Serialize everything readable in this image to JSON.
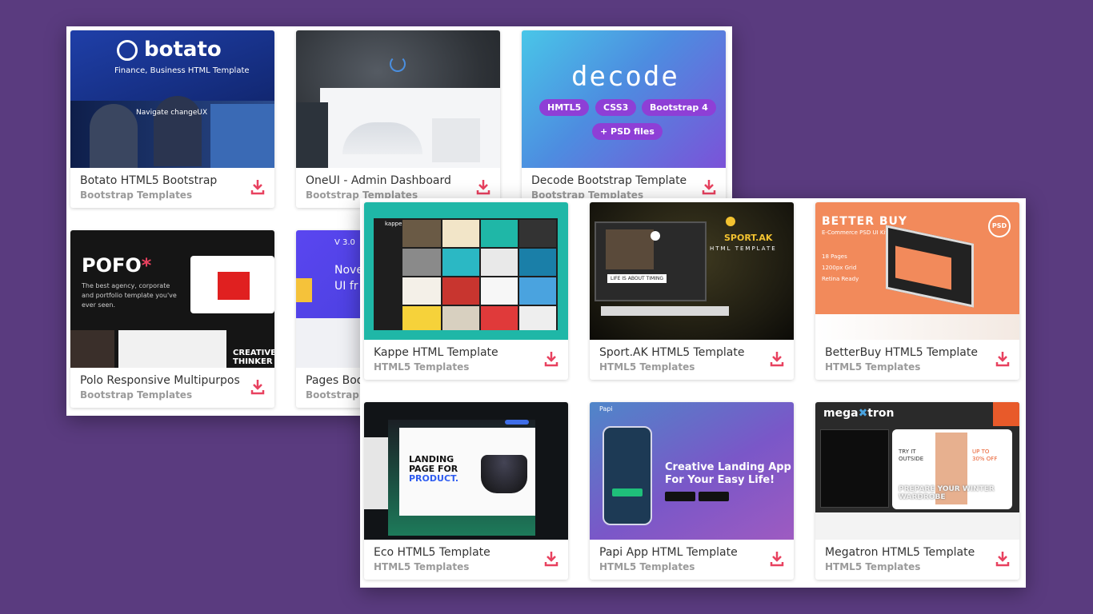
{
  "panels": {
    "back": [
      {
        "title": "Botato HTML5 Bootstrap",
        "category": "Bootstrap Templates",
        "thumb": {
          "brand": "botato",
          "subtitle": "Finance, Business HTML Template",
          "hero_text": "Navigate changeUX"
        }
      },
      {
        "title": "OneUI - Admin Dashboard",
        "category": "Bootstrap Templates"
      },
      {
        "title": "Decode Bootstrap Template",
        "category": "Bootstrap Templates",
        "thumb": {
          "brand": "decode",
          "pills": [
            "HMTL5",
            "CSS3",
            "Bootstrap 4",
            "+ PSD files"
          ]
        }
      },
      {
        "title": "Polo Responsive Multipurpose",
        "category": "Bootstrap Templates",
        "thumb": {
          "brand": "POFO",
          "brand_mark": "*",
          "tagline": "The best agency, corporate and portfolio template you've ever seen.",
          "side_text": "CREATIVE THINKER"
        }
      },
      {
        "title": "Pages Boo",
        "category": "Bootstrap T",
        "thumb": {
          "version": "V 3.0",
          "hero": "Nove UI fr"
        }
      }
    ],
    "front": [
      {
        "title": "Kappe HTML Template",
        "category": "HTML5 Templates",
        "thumb": {
          "brand": "kappe"
        }
      },
      {
        "title": "Sport.AK HTML5 Template",
        "category": "HTML5 Templates",
        "thumb": {
          "brand": "SPORT.AK",
          "sub": "HTML TEMPLATE",
          "banner": "LIFE IS ABOUT TIMING"
        }
      },
      {
        "title": "BetterBuy HTML5 Template",
        "category": "HTML5 Templates",
        "thumb": {
          "brand": "BETTER BUY",
          "sub": "E-Commerce PSD UI Kit",
          "features": [
            "18 Pages",
            "1200px Grid",
            "Retina Ready"
          ],
          "badge": "PSD"
        }
      },
      {
        "title": "Eco HTML5 Template",
        "category": "HTML5 Templates",
        "thumb": {
          "hero": [
            "LANDING",
            "PAGE FOR",
            "PRODUCT."
          ]
        }
      },
      {
        "title": "Papi App HTML Template",
        "category": "HTML5 Templates",
        "thumb": {
          "brand": "Papi",
          "hero": [
            "Creative Landing App",
            "For Your Easy Life!"
          ]
        }
      },
      {
        "title": "Megatron HTML5 Template",
        "category": "HTML5 Templates",
        "thumb": {
          "brand_a": "mega",
          "brand_b": "tron",
          "promo": [
            "TRY IT",
            "OUTSIDE"
          ],
          "discount": [
            "UP TO",
            "30% OFF"
          ],
          "headline": "PREPARE YOUR WINTER WARDROBE"
        }
      }
    ]
  },
  "icons": {
    "download": "download-icon"
  },
  "colors": {
    "background": "#5a3b7f",
    "accent": "#e8415f",
    "category": "#9a9a9a",
    "title": "#333333"
  }
}
